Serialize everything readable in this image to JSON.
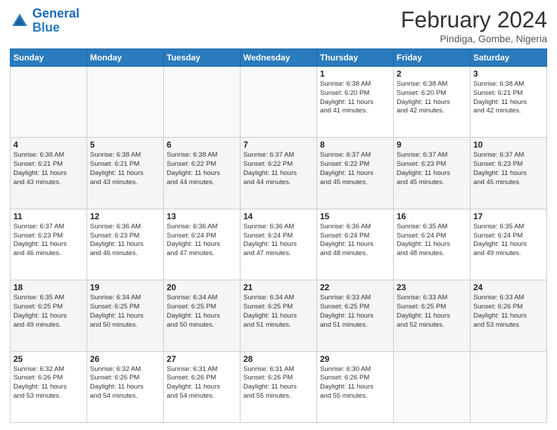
{
  "logo": {
    "line1": "General",
    "line2": "Blue"
  },
  "title": "February 2024",
  "subtitle": "Pindiga, Gombe, Nigeria",
  "days_of_week": [
    "Sunday",
    "Monday",
    "Tuesday",
    "Wednesday",
    "Thursday",
    "Friday",
    "Saturday"
  ],
  "weeks": [
    [
      {
        "day": "",
        "info": ""
      },
      {
        "day": "",
        "info": ""
      },
      {
        "day": "",
        "info": ""
      },
      {
        "day": "",
        "info": ""
      },
      {
        "day": "1",
        "info": "Sunrise: 6:38 AM\nSunset: 6:20 PM\nDaylight: 11 hours\nand 41 minutes."
      },
      {
        "day": "2",
        "info": "Sunrise: 6:38 AM\nSunset: 6:20 PM\nDaylight: 11 hours\nand 42 minutes."
      },
      {
        "day": "3",
        "info": "Sunrise: 6:38 AM\nSunset: 6:21 PM\nDaylight: 11 hours\nand 42 minutes."
      }
    ],
    [
      {
        "day": "4",
        "info": "Sunrise: 6:38 AM\nSunset: 6:21 PM\nDaylight: 11 hours\nand 43 minutes."
      },
      {
        "day": "5",
        "info": "Sunrise: 6:38 AM\nSunset: 6:21 PM\nDaylight: 11 hours\nand 43 minutes."
      },
      {
        "day": "6",
        "info": "Sunrise: 6:38 AM\nSunset: 6:22 PM\nDaylight: 11 hours\nand 44 minutes."
      },
      {
        "day": "7",
        "info": "Sunrise: 6:37 AM\nSunset: 6:22 PM\nDaylight: 11 hours\nand 44 minutes."
      },
      {
        "day": "8",
        "info": "Sunrise: 6:37 AM\nSunset: 6:22 PM\nDaylight: 11 hours\nand 45 minutes."
      },
      {
        "day": "9",
        "info": "Sunrise: 6:37 AM\nSunset: 6:23 PM\nDaylight: 11 hours\nand 45 minutes."
      },
      {
        "day": "10",
        "info": "Sunrise: 6:37 AM\nSunset: 6:23 PM\nDaylight: 11 hours\nand 45 minutes."
      }
    ],
    [
      {
        "day": "11",
        "info": "Sunrise: 6:37 AM\nSunset: 6:23 PM\nDaylight: 11 hours\nand 46 minutes."
      },
      {
        "day": "12",
        "info": "Sunrise: 6:36 AM\nSunset: 6:23 PM\nDaylight: 11 hours\nand 46 minutes."
      },
      {
        "day": "13",
        "info": "Sunrise: 6:36 AM\nSunset: 6:24 PM\nDaylight: 11 hours\nand 47 minutes."
      },
      {
        "day": "14",
        "info": "Sunrise: 6:36 AM\nSunset: 6:24 PM\nDaylight: 11 hours\nand 47 minutes."
      },
      {
        "day": "15",
        "info": "Sunrise: 6:36 AM\nSunset: 6:24 PM\nDaylight: 11 hours\nand 48 minutes."
      },
      {
        "day": "16",
        "info": "Sunrise: 6:35 AM\nSunset: 6:24 PM\nDaylight: 11 hours\nand 48 minutes."
      },
      {
        "day": "17",
        "info": "Sunrise: 6:35 AM\nSunset: 6:24 PM\nDaylight: 11 hours\nand 49 minutes."
      }
    ],
    [
      {
        "day": "18",
        "info": "Sunrise: 6:35 AM\nSunset: 6:25 PM\nDaylight: 11 hours\nand 49 minutes."
      },
      {
        "day": "19",
        "info": "Sunrise: 6:34 AM\nSunset: 6:25 PM\nDaylight: 11 hours\nand 50 minutes."
      },
      {
        "day": "20",
        "info": "Sunrise: 6:34 AM\nSunset: 6:25 PM\nDaylight: 11 hours\nand 50 minutes."
      },
      {
        "day": "21",
        "info": "Sunrise: 6:34 AM\nSunset: 6:25 PM\nDaylight: 11 hours\nand 51 minutes."
      },
      {
        "day": "22",
        "info": "Sunrise: 6:33 AM\nSunset: 6:25 PM\nDaylight: 11 hours\nand 51 minutes."
      },
      {
        "day": "23",
        "info": "Sunrise: 6:33 AM\nSunset: 6:25 PM\nDaylight: 11 hours\nand 52 minutes."
      },
      {
        "day": "24",
        "info": "Sunrise: 6:33 AM\nSunset: 6:26 PM\nDaylight: 11 hours\nand 53 minutes."
      }
    ],
    [
      {
        "day": "25",
        "info": "Sunrise: 6:32 AM\nSunset: 6:26 PM\nDaylight: 11 hours\nand 53 minutes."
      },
      {
        "day": "26",
        "info": "Sunrise: 6:32 AM\nSunset: 6:26 PM\nDaylight: 11 hours\nand 54 minutes."
      },
      {
        "day": "27",
        "info": "Sunrise: 6:31 AM\nSunset: 6:26 PM\nDaylight: 11 hours\nand 54 minutes."
      },
      {
        "day": "28",
        "info": "Sunrise: 6:31 AM\nSunset: 6:26 PM\nDaylight: 11 hours\nand 55 minutes."
      },
      {
        "day": "29",
        "info": "Sunrise: 6:30 AM\nSunset: 6:26 PM\nDaylight: 11 hours\nand 55 minutes."
      },
      {
        "day": "",
        "info": ""
      },
      {
        "day": "",
        "info": ""
      }
    ]
  ]
}
